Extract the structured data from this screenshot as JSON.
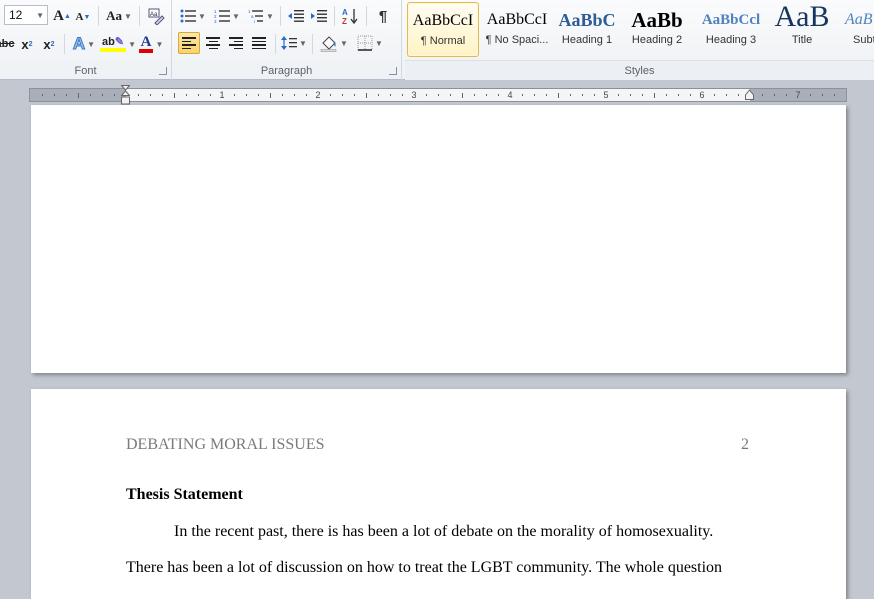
{
  "ribbon": {
    "font_group": {
      "label": "Font",
      "font_size": "12",
      "grow_font": "A",
      "shrink_font": "A",
      "change_case": "Aa",
      "strikethrough": "abc",
      "subscript": "x",
      "superscript": "x",
      "text_effects": "A",
      "highlight": "ab",
      "font_color": "A",
      "highlight_color": "#ffff00",
      "font_color_value": "#e00000"
    },
    "paragraph_group": {
      "label": "Paragraph",
      "show_marks": "¶",
      "sort": "A↓",
      "alignment_selected": "left"
    },
    "styles_group": {
      "label": "Styles",
      "items": [
        {
          "preview": "AaBbCcI",
          "name": "¶ Normal",
          "active": true
        },
        {
          "preview": "AaBbCcI",
          "name": "¶ No Spaci..."
        },
        {
          "preview": "AaBbC",
          "name": "Heading 1"
        },
        {
          "preview": "AaBb",
          "name": "Heading 2"
        },
        {
          "preview": "AaBbCcl",
          "name": "Heading 3"
        },
        {
          "preview": "AaB",
          "name": "Title"
        },
        {
          "preview": "AaB",
          "name": "Subtitle"
        }
      ]
    }
  },
  "ruler": {
    "numbers": [
      "1",
      "1",
      "2",
      "3",
      "4",
      "5",
      "6",
      "7"
    ]
  },
  "document": {
    "page2": {
      "running_head": "DEBATING MORAL ISSUES",
      "page_number": "2",
      "heading": "Thesis Statement",
      "paragraph_line1": "In the recent past, there is has been a lot of debate on the morality of homosexuality.",
      "paragraph_line2": "There has been a lot of discussion on how to treat the LGBT community. The whole question"
    }
  }
}
